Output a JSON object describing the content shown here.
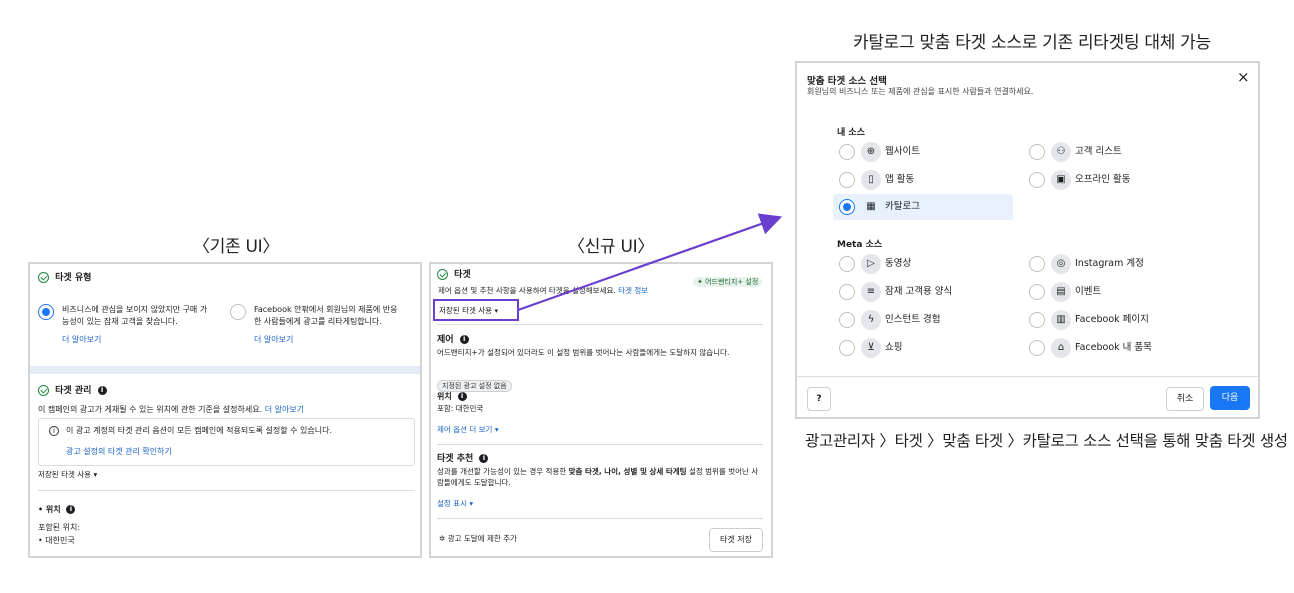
{
  "captions": {
    "old_ui": "〈기존 UI〉",
    "new_ui": "〈신규 UI〉",
    "top_right": "카탈로그 맞춤 타겟 소스로 기존 리타겟팅 대체 가능",
    "bottom_right": "광고관리자 〉타겟 〉맞춤 타겟 〉카탈로그 소스 선택을 통해 맞춤 타겟 생성"
  },
  "old_panel": {
    "target_type_title": "타겟 유형",
    "option1_text": "비즈니스에 관심을 보이지 않았지만 구매 가능성이 있는 잠재 고객을 찾습니다.",
    "option1_link": "더 알아보기",
    "option2_text": "Facebook 안팎에서 회원님의 제품에 반응한 사람들에게 광고를 리타게팅합니다.",
    "option2_link": "더 알아보기",
    "target_mgmt_title": "타겟 관리",
    "target_mgmt_desc": "이 캠페인의 광고가 게재될 수 있는 위치에 관한 기준을 설정하세요.",
    "target_mgmt_link": "더 알아보기",
    "notice_text": "이 광고 계정의 타겟 관리 옵션이 모든 캠페인에 적용되도록 설정할 수 있습니다.",
    "notice_link": "광고 설정의 타겟 관리 확인하기",
    "saved_target": "저장된 타겟 사용 ▾",
    "location_title": "• 위치",
    "location_included": "포함된 위치:",
    "location_value": "•  대한민국"
  },
  "new_panel": {
    "target_title": "타겟",
    "badge": "✦ 어드밴티지+ 설정",
    "target_desc": "제어 옵션 및 추천 사항을 사용하여 타겟을 설정해보세요.",
    "target_link": "타겟 정보",
    "saved_target": "저장된 타겟 사용",
    "control_title": "제어",
    "control_desc": "어드밴티지+가 설정되어 있더라도 이 설정 범위를 벗어나는 사람들에게는 도달하지 않습니다.",
    "control_tag": "지정된 광고 설정 없음",
    "location_title": "위치",
    "location_value": "포함: 대한민국",
    "more_control": "제어 옵션 더 보기 ▾",
    "suggest_title": "타겟 추천",
    "suggest_desc_1": "성과를 개선할 가능성이 있는 경우 적용한 ",
    "suggest_desc_bold": "맞춤 타겟, 나이, 성별 및 상세 타게팅",
    "suggest_desc_2": " 설정 범위를 벗어난 사람들에게도 도달합니다.",
    "show_settings": "설정 표시 ▾",
    "limit_reach": "광고 도달에 제한 추가",
    "save_target": "타겟 저장"
  },
  "modal": {
    "title": "맞춤 타겟 소스 선택",
    "subtitle": "회원님의 비즈니스 또는 제품에 관심을 표시한 사람들과 연결하세요.",
    "my_sources": "내 소스",
    "meta_sources": "Meta 소스",
    "my_items": [
      {
        "label": "웹사이트",
        "icon": "globe-icon",
        "glyph": "⊕"
      },
      {
        "label": "고객 리스트",
        "icon": "people-icon",
        "glyph": "⚇"
      },
      {
        "label": "앱 활동",
        "icon": "phone-icon",
        "glyph": "▯"
      },
      {
        "label": "오프라인 활동",
        "icon": "store-icon",
        "glyph": "▣"
      },
      {
        "label": "카탈로그",
        "icon": "grid-icon",
        "glyph": "▦"
      }
    ],
    "meta_items": [
      {
        "label": "동영상",
        "icon": "play-icon",
        "glyph": "▷"
      },
      {
        "label": "Instagram 계정",
        "icon": "instagram-icon",
        "glyph": "◎"
      },
      {
        "label": "잠재 고객용 양식",
        "icon": "form-icon",
        "glyph": "≡"
      },
      {
        "label": "이벤트",
        "icon": "event-icon",
        "glyph": "▤"
      },
      {
        "label": "인스턴트 경험",
        "icon": "bolt-icon",
        "glyph": "ϟ"
      },
      {
        "label": "Facebook 페이지",
        "icon": "page-icon",
        "glyph": "▥"
      },
      {
        "label": "쇼핑",
        "icon": "cart-icon",
        "glyph": "⊻"
      },
      {
        "label": "Facebook 내 품목",
        "icon": "shop-icon",
        "glyph": "⌂"
      }
    ],
    "help": "?",
    "cancel": "취소",
    "next": "다음",
    "close": "×"
  },
  "colors": {
    "accent": "#1877f2",
    "highlight_box": "#6a3fcf",
    "arrow": "#6a3fcf",
    "selected_row": "#e7f0fb"
  }
}
